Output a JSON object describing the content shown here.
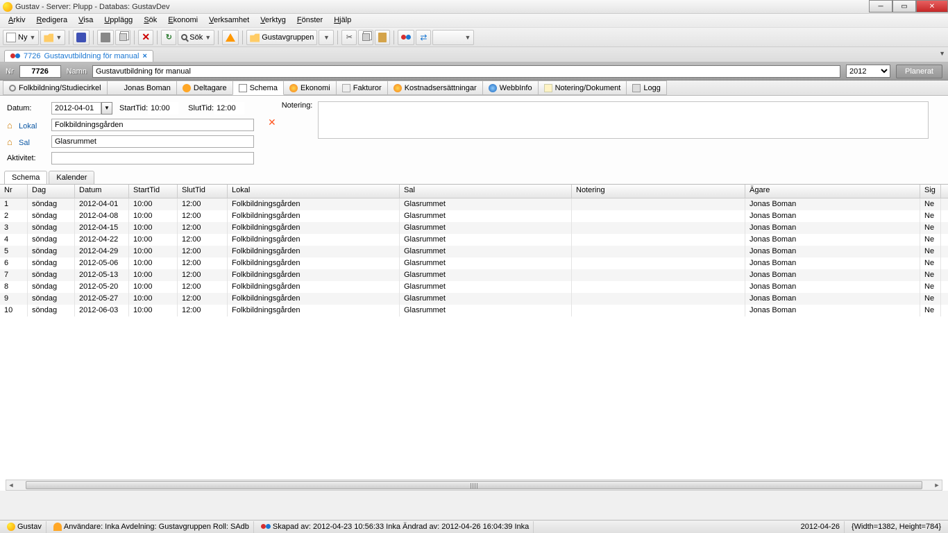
{
  "title": "Gustav  -  Server: Plupp  -  Databas: GustavDev",
  "menus": [
    "Arkiv",
    "Redigera",
    "Visa",
    "Upplägg",
    "Sök",
    "Ekonomi",
    "Verksamhet",
    "Verktyg",
    "Fönster",
    "Hjälp"
  ],
  "toolbar": {
    "ny": "Ny",
    "sok": "Sök",
    "group": "Gustavgruppen"
  },
  "doctab": {
    "id": "7726",
    "title": "Gustavutbildning för manual"
  },
  "header": {
    "nr_label": "Nr",
    "nr": "7726",
    "namn_label": "Namn",
    "namn": "Gustavutbildning för manual",
    "year": "2012",
    "status": "Planerat"
  },
  "detail_tabs": [
    "Folkbildning/Studiecirkel",
    "Jonas Boman",
    "Deltagare",
    "Schema",
    "Ekonomi",
    "Fakturor",
    "Kostnadsersättningar",
    "WebbInfo",
    "Notering/Dokument",
    "Logg"
  ],
  "form": {
    "datum_label": "Datum:",
    "datum": "2012-04-01",
    "starttid_label": "StartTid:",
    "starttid": "10:00",
    "sluttid_label": "SlutTid:",
    "sluttid": "12:00",
    "lokal_label": "Lokal",
    "lokal": "Folkbildningsgården",
    "sal_label": "Sal",
    "sal": "Glasrummet",
    "aktivitet_label": "Aktivitet:",
    "aktivitet": "",
    "notering_label": "Notering:"
  },
  "subtabs": [
    "Schema",
    "Kalender"
  ],
  "grid": {
    "headers": [
      "Nr",
      "Dag",
      "Datum",
      "StartTid",
      "SlutTid",
      "Lokal",
      "Sal",
      "Notering",
      "Ägare",
      "Sig"
    ],
    "rows": [
      {
        "nr": "1",
        "dag": "söndag",
        "datum": "2012-04-01",
        "start": "10:00",
        "slut": "12:00",
        "lokal": "Folkbildningsgården",
        "sal": "Glasrummet",
        "not": "",
        "agare": "Jonas Boman",
        "sig": "Ne"
      },
      {
        "nr": "2",
        "dag": "söndag",
        "datum": "2012-04-08",
        "start": "10:00",
        "slut": "12:00",
        "lokal": "Folkbildningsgården",
        "sal": "Glasrummet",
        "not": "",
        "agare": "Jonas Boman",
        "sig": "Ne"
      },
      {
        "nr": "3",
        "dag": "söndag",
        "datum": "2012-04-15",
        "start": "10:00",
        "slut": "12:00",
        "lokal": "Folkbildningsgården",
        "sal": "Glasrummet",
        "not": "",
        "agare": "Jonas Boman",
        "sig": "Ne"
      },
      {
        "nr": "4",
        "dag": "söndag",
        "datum": "2012-04-22",
        "start": "10:00",
        "slut": "12:00",
        "lokal": "Folkbildningsgården",
        "sal": "Glasrummet",
        "not": "",
        "agare": "Jonas Boman",
        "sig": "Ne"
      },
      {
        "nr": "5",
        "dag": "söndag",
        "datum": "2012-04-29",
        "start": "10:00",
        "slut": "12:00",
        "lokal": "Folkbildningsgården",
        "sal": "Glasrummet",
        "not": "",
        "agare": "Jonas Boman",
        "sig": "Ne"
      },
      {
        "nr": "6",
        "dag": "söndag",
        "datum": "2012-05-06",
        "start": "10:00",
        "slut": "12:00",
        "lokal": "Folkbildningsgården",
        "sal": "Glasrummet",
        "not": "",
        "agare": "Jonas Boman",
        "sig": "Ne"
      },
      {
        "nr": "7",
        "dag": "söndag",
        "datum": "2012-05-13",
        "start": "10:00",
        "slut": "12:00",
        "lokal": "Folkbildningsgården",
        "sal": "Glasrummet",
        "not": "",
        "agare": "Jonas Boman",
        "sig": "Ne"
      },
      {
        "nr": "8",
        "dag": "söndag",
        "datum": "2012-05-20",
        "start": "10:00",
        "slut": "12:00",
        "lokal": "Folkbildningsgården",
        "sal": "Glasrummet",
        "not": "",
        "agare": "Jonas Boman",
        "sig": "Ne"
      },
      {
        "nr": "9",
        "dag": "söndag",
        "datum": "2012-05-27",
        "start": "10:00",
        "slut": "12:00",
        "lokal": "Folkbildningsgården",
        "sal": "Glasrummet",
        "not": "",
        "agare": "Jonas Boman",
        "sig": "Ne"
      },
      {
        "nr": "10",
        "dag": "söndag",
        "datum": "2012-06-03",
        "start": "10:00",
        "slut": "12:00",
        "lokal": "Folkbildningsgården",
        "sal": "Glasrummet",
        "not": "",
        "agare": "Jonas Boman",
        "sig": "Ne"
      }
    ]
  },
  "status": {
    "app": "Gustav",
    "user": "Användare: Inka Avdelning: Gustavgruppen Roll: SAdb",
    "created": "Skapad av: 2012-04-23 10:56:33 Inka Ändrad av: 2012-04-26 16:04:39 Inka",
    "date": "2012-04-26",
    "dims": "{Width=1382, Height=784}"
  }
}
